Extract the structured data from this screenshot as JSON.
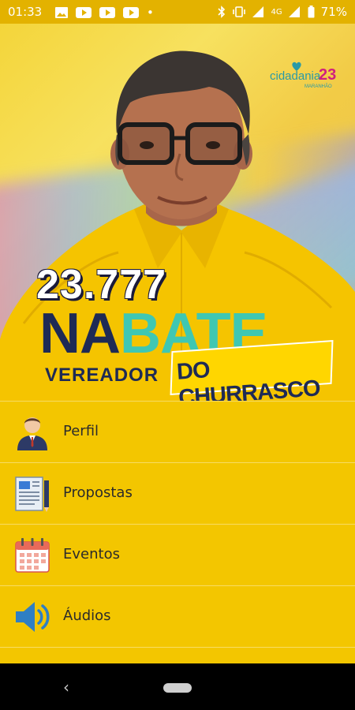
{
  "status_bar": {
    "time": "01:33",
    "dot": "•",
    "network": "4G",
    "battery": "71%"
  },
  "hero": {
    "party_name": "cidadania",
    "party_number": "23",
    "party_state": "MARANHÃO",
    "candidate_number": "23.777",
    "name_part1": "NA",
    "name_part2": "BATE",
    "role": "VEREADOR",
    "nickname": "DO CHURRASCO"
  },
  "menu": {
    "items": [
      {
        "label": "Perfil",
        "icon": "user-avatar-icon"
      },
      {
        "label": "Propostas",
        "icon": "document-icon"
      },
      {
        "label": "Eventos",
        "icon": "calendar-icon"
      },
      {
        "label": "Áudios",
        "icon": "speaker-icon"
      }
    ]
  },
  "nav": {
    "back": "‹"
  },
  "colors": {
    "status_bar": "#e3b200",
    "menu_background": "#f3c600",
    "name_navy": "#1e2a55",
    "name_teal": "#3fc7b2"
  }
}
